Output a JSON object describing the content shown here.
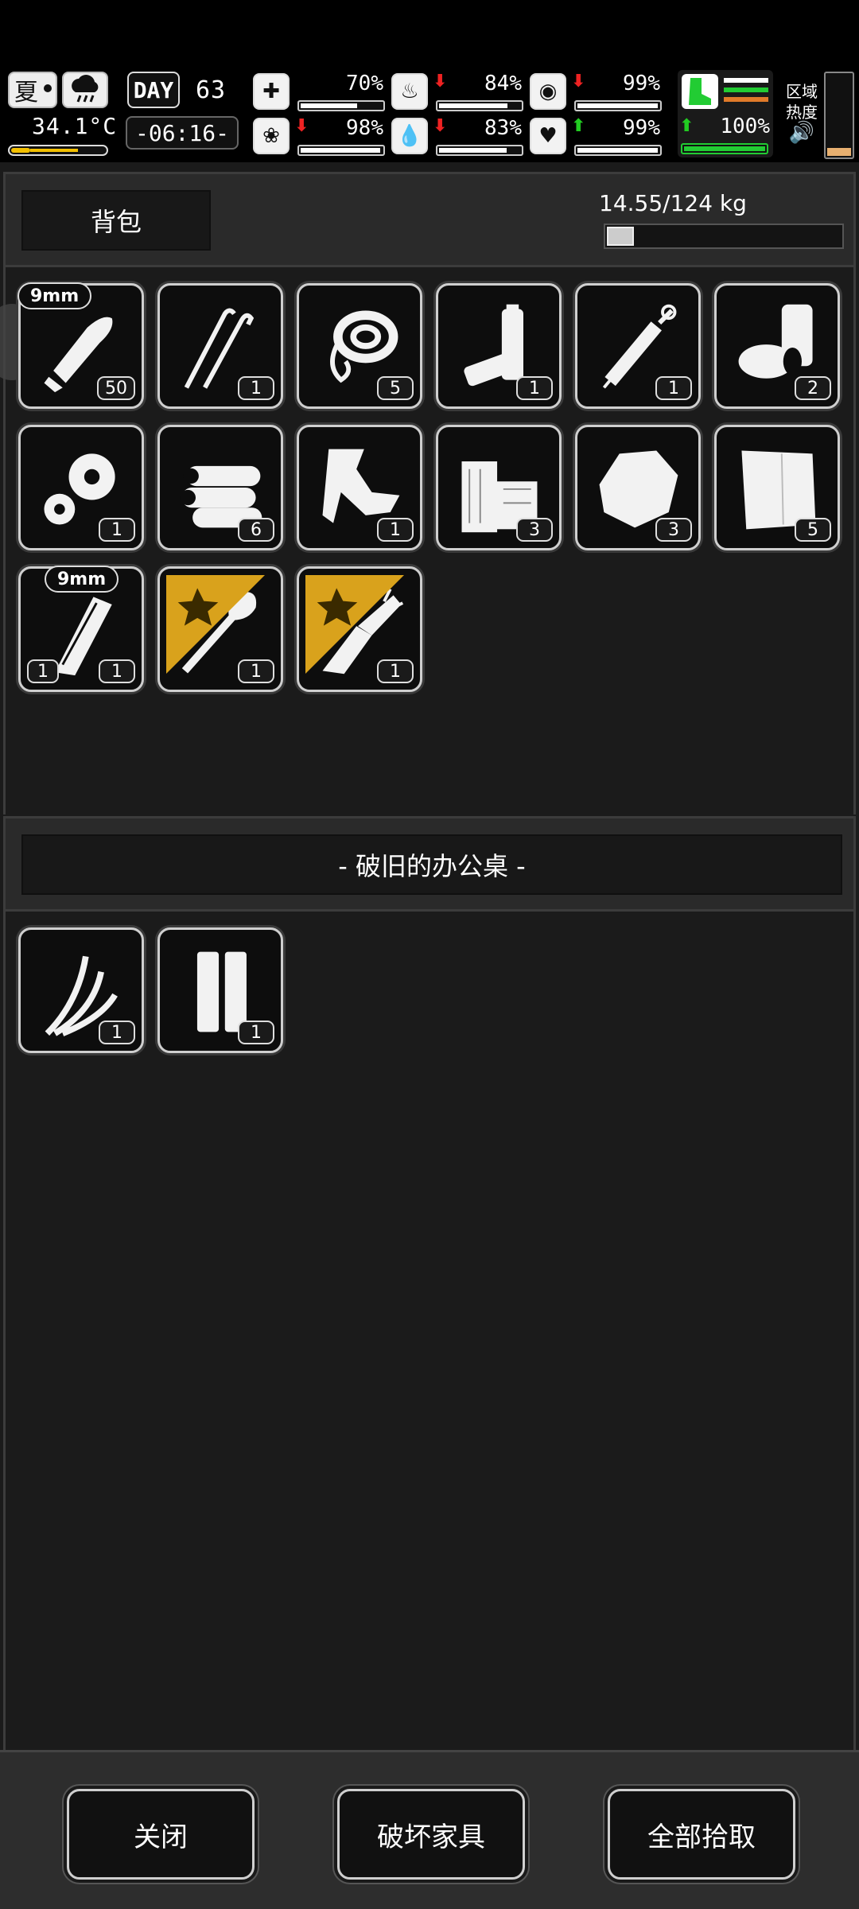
{
  "hud": {
    "season": "夏",
    "temperature": "34.1°C",
    "day_label": "DAY",
    "day_number": "63",
    "time": "-06:16-",
    "stats": [
      {
        "icon": "medkit-icon",
        "arrow": "",
        "value": "70%",
        "fill": 0.7
      },
      {
        "icon": "stomach-icon",
        "arrow": "down",
        "value": "84%",
        "fill": 0.84
      },
      {
        "icon": "pill-icon",
        "arrow": "down",
        "value": "99%",
        "fill": 0.99
      },
      {
        "icon": "brain-icon",
        "arrow": "down",
        "value": "98%",
        "fill": 0.98
      },
      {
        "icon": "water-drop-icon",
        "arrow": "down",
        "value": "83%",
        "fill": 0.83
      },
      {
        "icon": "heart-icon",
        "arrow": "up",
        "value": "99%",
        "fill": 0.99
      }
    ],
    "stamina": {
      "arrow": "up",
      "value": "100%",
      "fill": 1.0
    },
    "zone_heat_label_1": "区域",
    "zone_heat_label_2": "热度",
    "colors": {
      "up": "#22cc22",
      "down": "#ee2222",
      "stamina": "#22cc33",
      "heat": "#e8b070"
    }
  },
  "backpack": {
    "title": "背包",
    "weight": "14.55/124 kg",
    "weight_fill": 0.117,
    "items": [
      {
        "name": "bullet-9mm-icon",
        "count": "50",
        "tag": "9mm"
      },
      {
        "name": "lockpick-icon",
        "count": "1"
      },
      {
        "name": "rope-icon",
        "count": "5"
      },
      {
        "name": "battery-icon",
        "count": "1"
      },
      {
        "name": "syringe-icon",
        "count": "1"
      },
      {
        "name": "tape-roll-icon",
        "count": "2"
      },
      {
        "name": "gears-icon",
        "count": "1"
      },
      {
        "name": "logs-icon",
        "count": "6"
      },
      {
        "name": "scrap-metal-icon",
        "count": "1"
      },
      {
        "name": "wood-planks-icon",
        "count": "3"
      },
      {
        "name": "rock-icon",
        "count": "3"
      },
      {
        "name": "cloth-icon",
        "count": "5"
      },
      {
        "name": "magazine-icon",
        "count": "1",
        "count_left": "1",
        "tag": "9mm"
      },
      {
        "name": "shovel-icon",
        "count": "1",
        "starred": true
      },
      {
        "name": "combat-knife-icon",
        "count": "1",
        "starred": true
      }
    ]
  },
  "container": {
    "title": "- 破旧的办公桌 -",
    "items": [
      {
        "name": "wires-icon",
        "count": "1"
      },
      {
        "name": "bullet-casings-icon",
        "count": "1"
      }
    ]
  },
  "actions": {
    "close": "关闭",
    "destroy": "破坏家具",
    "take_all": "全部拾取"
  }
}
